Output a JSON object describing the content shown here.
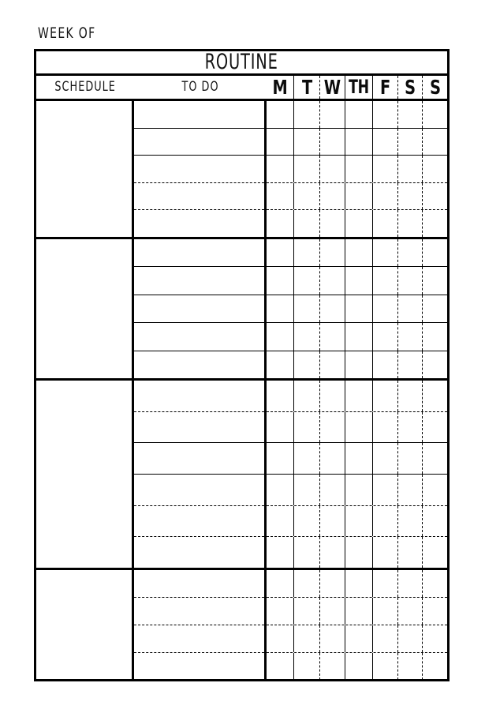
{
  "page": {
    "background_color": "#ffffff",
    "ink_color": "#111111"
  },
  "caption": {
    "week_of_label": "WEEK OF"
  },
  "header": {
    "title": "ROUTINE",
    "schedule_label": "SCHEDULE",
    "todo_label": "TO DO"
  },
  "days": [
    {
      "label": "M",
      "key": "monday",
      "divider": "solid"
    },
    {
      "label": "T",
      "key": "tuesday",
      "divider": "dashed"
    },
    {
      "label": "W",
      "key": "wednesday",
      "divider": "solid"
    },
    {
      "label": "TH",
      "key": "thursday",
      "divider": "solid"
    },
    {
      "label": "F",
      "key": "friday",
      "divider": "dashed"
    },
    {
      "label": "S",
      "key": "saturday",
      "divider": "dashed"
    },
    {
      "label": "S",
      "key": "sunday",
      "divider": "none"
    }
  ],
  "blocks": [
    {
      "index": 1,
      "schedule_value": "",
      "rows": [
        {
          "todo_value": "",
          "separator": "solid"
        },
        {
          "todo_value": "",
          "separator": "solid"
        },
        {
          "todo_value": "",
          "separator": "dashed"
        },
        {
          "todo_value": "",
          "separator": "dashed"
        },
        {
          "todo_value": "",
          "separator": "none"
        }
      ]
    },
    {
      "index": 2,
      "schedule_value": "",
      "rows": [
        {
          "todo_value": "",
          "separator": "solid"
        },
        {
          "todo_value": "",
          "separator": "solid"
        },
        {
          "todo_value": "",
          "separator": "solid"
        },
        {
          "todo_value": "",
          "separator": "solid"
        },
        {
          "todo_value": "",
          "separator": "none"
        }
      ]
    },
    {
      "index": 3,
      "schedule_value": "",
      "rows": [
        {
          "todo_value": "",
          "separator": "dashed"
        },
        {
          "todo_value": "",
          "separator": "solid"
        },
        {
          "todo_value": "",
          "separator": "solid"
        },
        {
          "todo_value": "",
          "separator": "dashed"
        },
        {
          "todo_value": "",
          "separator": "dashed"
        },
        {
          "todo_value": "",
          "separator": "none"
        }
      ]
    },
    {
      "index": 4,
      "schedule_value": "",
      "rows": [
        {
          "todo_value": "",
          "separator": "dashed"
        },
        {
          "todo_value": "",
          "separator": "dashed"
        },
        {
          "todo_value": "",
          "separator": "dashed"
        },
        {
          "todo_value": "",
          "separator": "none"
        }
      ]
    }
  ]
}
